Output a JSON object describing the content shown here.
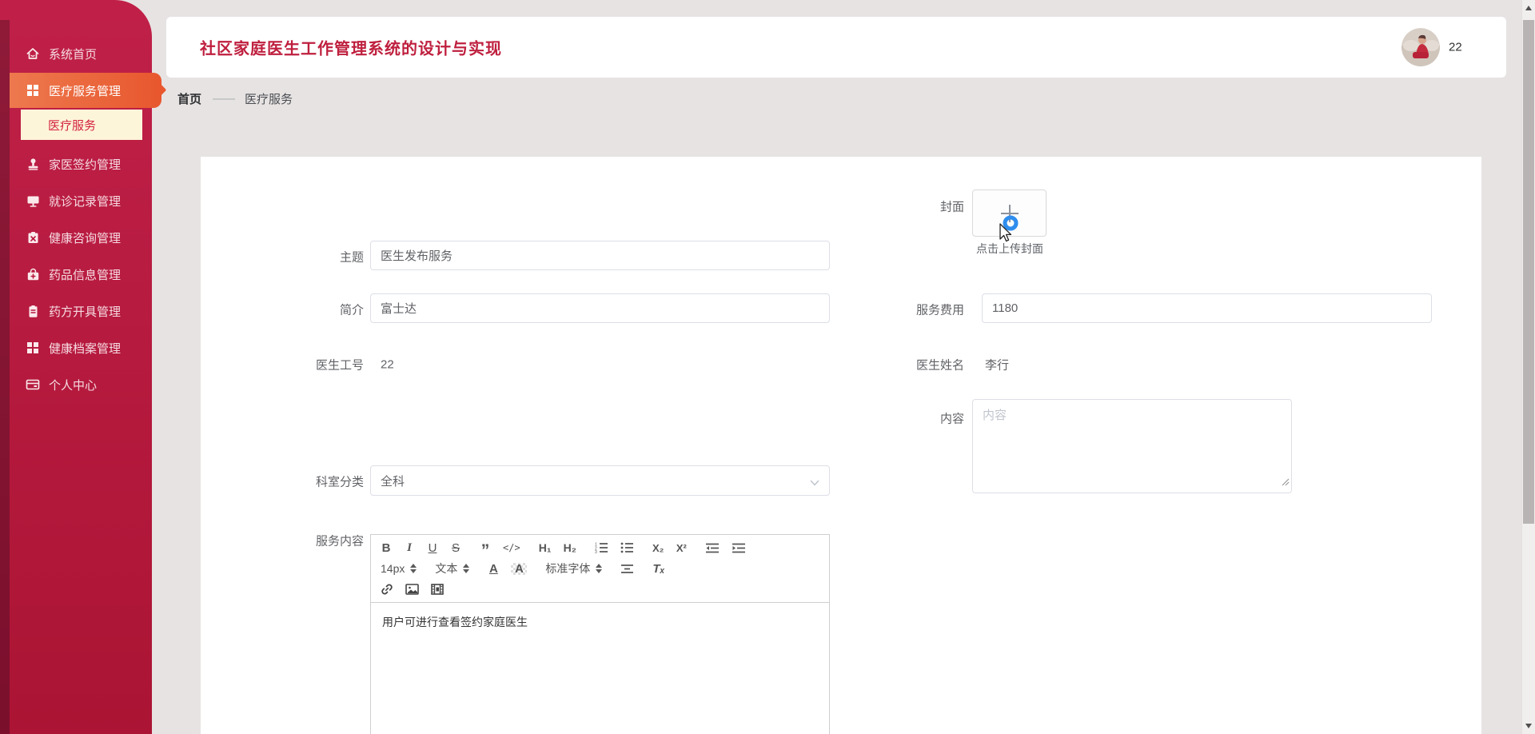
{
  "app": {
    "window_title": "社区家庭医生工作管理系统的设计与实现",
    "user_badge": "22"
  },
  "sidebar": {
    "items": [
      {
        "label": "系统首页",
        "icon": "home-icon",
        "active": false
      },
      {
        "label": "医疗服务管理",
        "icon": "grid-icon",
        "active": true,
        "children": [
          {
            "label": "医疗服务",
            "active": true
          }
        ]
      },
      {
        "label": "家医签约管理",
        "icon": "seal-icon",
        "active": false
      },
      {
        "label": "就诊记录管理",
        "icon": "monitor-icon",
        "active": false
      },
      {
        "label": "健康咨询管理",
        "icon": "clipboard-x-icon",
        "active": false
      },
      {
        "label": "药品信息管理",
        "icon": "medicine-bag-icon",
        "active": false
      },
      {
        "label": "药方开具管理",
        "icon": "clipboard-icon",
        "active": false
      },
      {
        "label": "健康档案管理",
        "icon": "grid-icon",
        "active": false
      },
      {
        "label": "个人中心",
        "icon": "id-card-icon",
        "active": false
      }
    ]
  },
  "breadcrumb": {
    "home": "首页",
    "separator": "——",
    "current": "医疗服务"
  },
  "form": {
    "cover": {
      "label": "封面",
      "hint": "点击上传封面"
    },
    "subject": {
      "label": "主题",
      "value": "医生发布服务"
    },
    "intro": {
      "label": "简介",
      "value": "富士达"
    },
    "doctor_no": {
      "label": "医生工号",
      "value": "22"
    },
    "fee": {
      "label": "服务费用",
      "value": "1180"
    },
    "doctor_name": {
      "label": "医生姓名",
      "value": "李行"
    },
    "content": {
      "label": "内容",
      "placeholder": "内容"
    },
    "department": {
      "label": "科室分类",
      "value": "全科"
    },
    "service_content": {
      "label": "服务内容",
      "text": "用户可进行查看签约家庭医生"
    }
  },
  "editor": {
    "bold": "B",
    "italic": "I",
    "underline": "U",
    "strike": "S",
    "quote": "”",
    "code": "</>",
    "h1": "H₁",
    "h2": "H₂",
    "subscript": "X₂",
    "superscript": "X²",
    "font_size": "14px",
    "text_type": "文本",
    "font_color": "A",
    "bg_color": "A",
    "font_family": "标准字体",
    "clear_format": "Tₓ"
  },
  "colors": {
    "sidebar_top": "#c02048",
    "sidebar_bottom": "#ab1434",
    "active_orange": "#e8572e",
    "submenu_bg": "#fdf5d9",
    "accent_red": "#bf1f3e",
    "page_bg": "#e7e3e3",
    "input_border": "#dcdfe6",
    "upload_ring_blue": "#2f8ded"
  }
}
